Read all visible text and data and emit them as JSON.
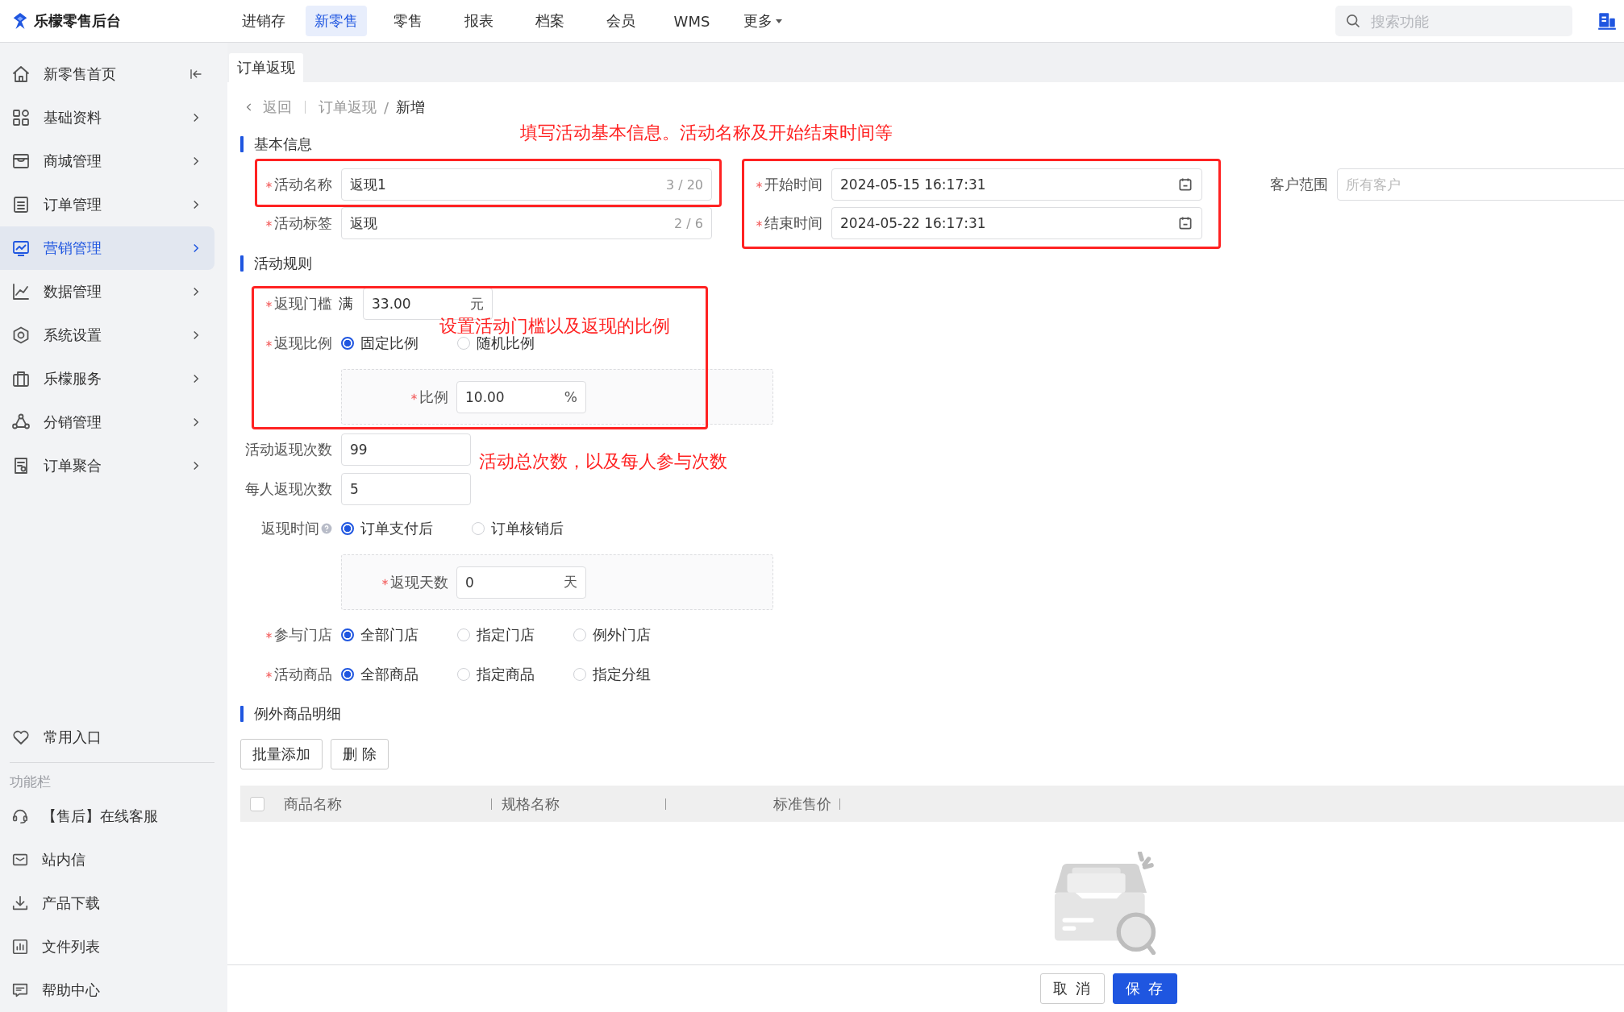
{
  "brand": {
    "name": "乐檬零售后台"
  },
  "nav": [
    {
      "label": "进销存",
      "selected": false,
      "dropdown": false
    },
    {
      "label": "新零售",
      "selected": true,
      "dropdown": false
    },
    {
      "label": "零售",
      "selected": false,
      "dropdown": false
    },
    {
      "label": "报表",
      "selected": false,
      "dropdown": false
    },
    {
      "label": "档案",
      "selected": false,
      "dropdown": false
    },
    {
      "label": "会员",
      "selected": false,
      "dropdown": false
    },
    {
      "label": "WMS",
      "selected": false,
      "dropdown": false
    },
    {
      "label": "更多",
      "selected": false,
      "dropdown": true
    }
  ],
  "search": {
    "placeholder": "搜索功能"
  },
  "sidebar": {
    "items": [
      {
        "label": "新零售首页",
        "selected": false,
        "kind": "collapse"
      },
      {
        "label": "基础资料",
        "selected": false,
        "kind": "submenu"
      },
      {
        "label": "商城管理",
        "selected": false,
        "kind": "submenu"
      },
      {
        "label": "订单管理",
        "selected": false,
        "kind": "submenu"
      },
      {
        "label": "营销管理",
        "selected": true,
        "kind": "submenu"
      },
      {
        "label": "数据管理",
        "selected": false,
        "kind": "submenu"
      },
      {
        "label": "系统设置",
        "selected": false,
        "kind": "submenu"
      },
      {
        "label": "乐檬服务",
        "selected": false,
        "kind": "submenu"
      },
      {
        "label": "分销管理",
        "selected": false,
        "kind": "submenu"
      },
      {
        "label": "订单聚合",
        "selected": false,
        "kind": "submenu"
      }
    ],
    "shortcut": {
      "label": "常用入口"
    },
    "section_title": "功能栏",
    "tools": [
      {
        "label": "【售后】在线客服"
      },
      {
        "label": "站内信"
      },
      {
        "label": "产品下载"
      },
      {
        "label": "文件列表"
      },
      {
        "label": "帮助中心"
      }
    ]
  },
  "tabs": [
    {
      "label": "订单返现",
      "selected": true
    }
  ],
  "breadcrumb": {
    "back": "返回",
    "path": [
      "订单返现",
      "新增"
    ],
    "separator": "/"
  },
  "basic": {
    "title": "基本信息",
    "fields": [
      {
        "label": "活动名称",
        "required": true,
        "value": "返现1",
        "counter": "3 / 20"
      },
      {
        "label": "活动标签",
        "required": true,
        "value": "返现",
        "counter": "2 / 6"
      }
    ],
    "times": [
      {
        "label": "开始时间",
        "required": true,
        "value": "2024-05-15 16:17:31"
      },
      {
        "label": "结束时间",
        "required": true,
        "value": "2024-05-22 16:17:31"
      }
    ],
    "customer": {
      "label": "客户范围",
      "required": false,
      "placeholder": "所有客户"
    }
  },
  "rules": {
    "title": "活动规则",
    "threshold": {
      "label": "返现门槛",
      "required": true,
      "prefix": "满",
      "value": "33.00",
      "suffix": "元"
    },
    "ratio": {
      "label": "返现比例",
      "required": true,
      "help": false,
      "options": [
        {
          "label": "固定比例",
          "selected": true
        },
        {
          "label": "随机比例",
          "selected": false
        }
      ],
      "sub": {
        "label": "比例",
        "required": true,
        "value": "10.00",
        "suffix": "%"
      }
    },
    "total": {
      "label": "活动返现次数",
      "required": false,
      "value": "99"
    },
    "per_person": {
      "label": "每人返现次数",
      "required": false,
      "value": "5"
    },
    "time": {
      "label": "返现时间",
      "required": false,
      "help": true,
      "options": [
        {
          "label": "订单支付后",
          "selected": true
        },
        {
          "label": "订单核销后",
          "selected": false
        }
      ],
      "sub": {
        "label": "返现天数",
        "required": true,
        "value": "0",
        "suffix": "天"
      }
    },
    "stores": {
      "label": "参与门店",
      "required": true,
      "help": false,
      "options": [
        {
          "label": "全部门店",
          "selected": true
        },
        {
          "label": "指定门店",
          "selected": false
        },
        {
          "label": "例外门店",
          "selected": false
        }
      ]
    },
    "goods": {
      "label": "活动商品",
      "required": true,
      "help": false,
      "options": [
        {
          "label": "全部商品",
          "selected": true
        },
        {
          "label": "指定商品",
          "selected": false
        },
        {
          "label": "指定分组",
          "selected": false
        }
      ]
    }
  },
  "exceptions": {
    "title": "例外商品明细",
    "buttons": [
      "批量添加",
      "删 除"
    ],
    "table": {
      "select_all": {
        "checked": false
      },
      "columns": [
        "商品名称",
        "规格名称",
        "标准售价"
      ]
    }
  },
  "footer": {
    "buttons": [
      {
        "label": "取 消",
        "kind": "default"
      },
      {
        "label": "保 存",
        "kind": "primary"
      }
    ]
  },
  "callouts": [
    {
      "kind": "note",
      "text": "填写活动基本信息。活动名称及开始结束时间等"
    },
    {
      "kind": "frame"
    },
    {
      "kind": "frame"
    },
    {
      "kind": "frame"
    },
    {
      "kind": "note",
      "text": "设置活动门槛以及返现的比例"
    },
    {
      "kind": "note",
      "text": "活动总次数，以及每人参与次数"
    }
  ]
}
